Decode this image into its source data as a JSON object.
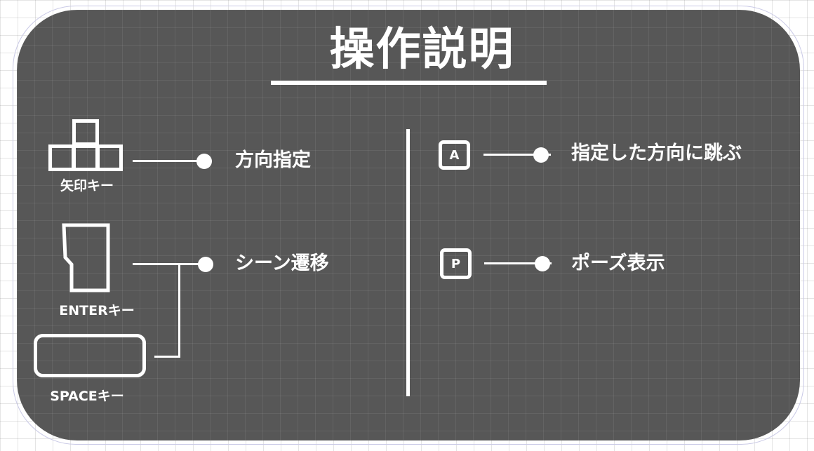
{
  "title": "操作説明",
  "left_controls": [
    {
      "key_label": "矢印キー",
      "icon": "arrow-keys-icon",
      "action": "方向指定"
    },
    {
      "key_label": "ENTERキー",
      "icon": "enter-key-icon",
      "action": "シーン遷移"
    },
    {
      "key_label": "SPACEキー",
      "icon": "space-key-icon",
      "action": "シーン遷移"
    }
  ],
  "right_controls": [
    {
      "key": "A",
      "action": "指定した方向に跳ぶ"
    },
    {
      "key": "P",
      "action": "ポーズ表示"
    }
  ],
  "colors": {
    "panel": "#575757",
    "foreground": "#ffffff",
    "background": "#ffffff"
  }
}
